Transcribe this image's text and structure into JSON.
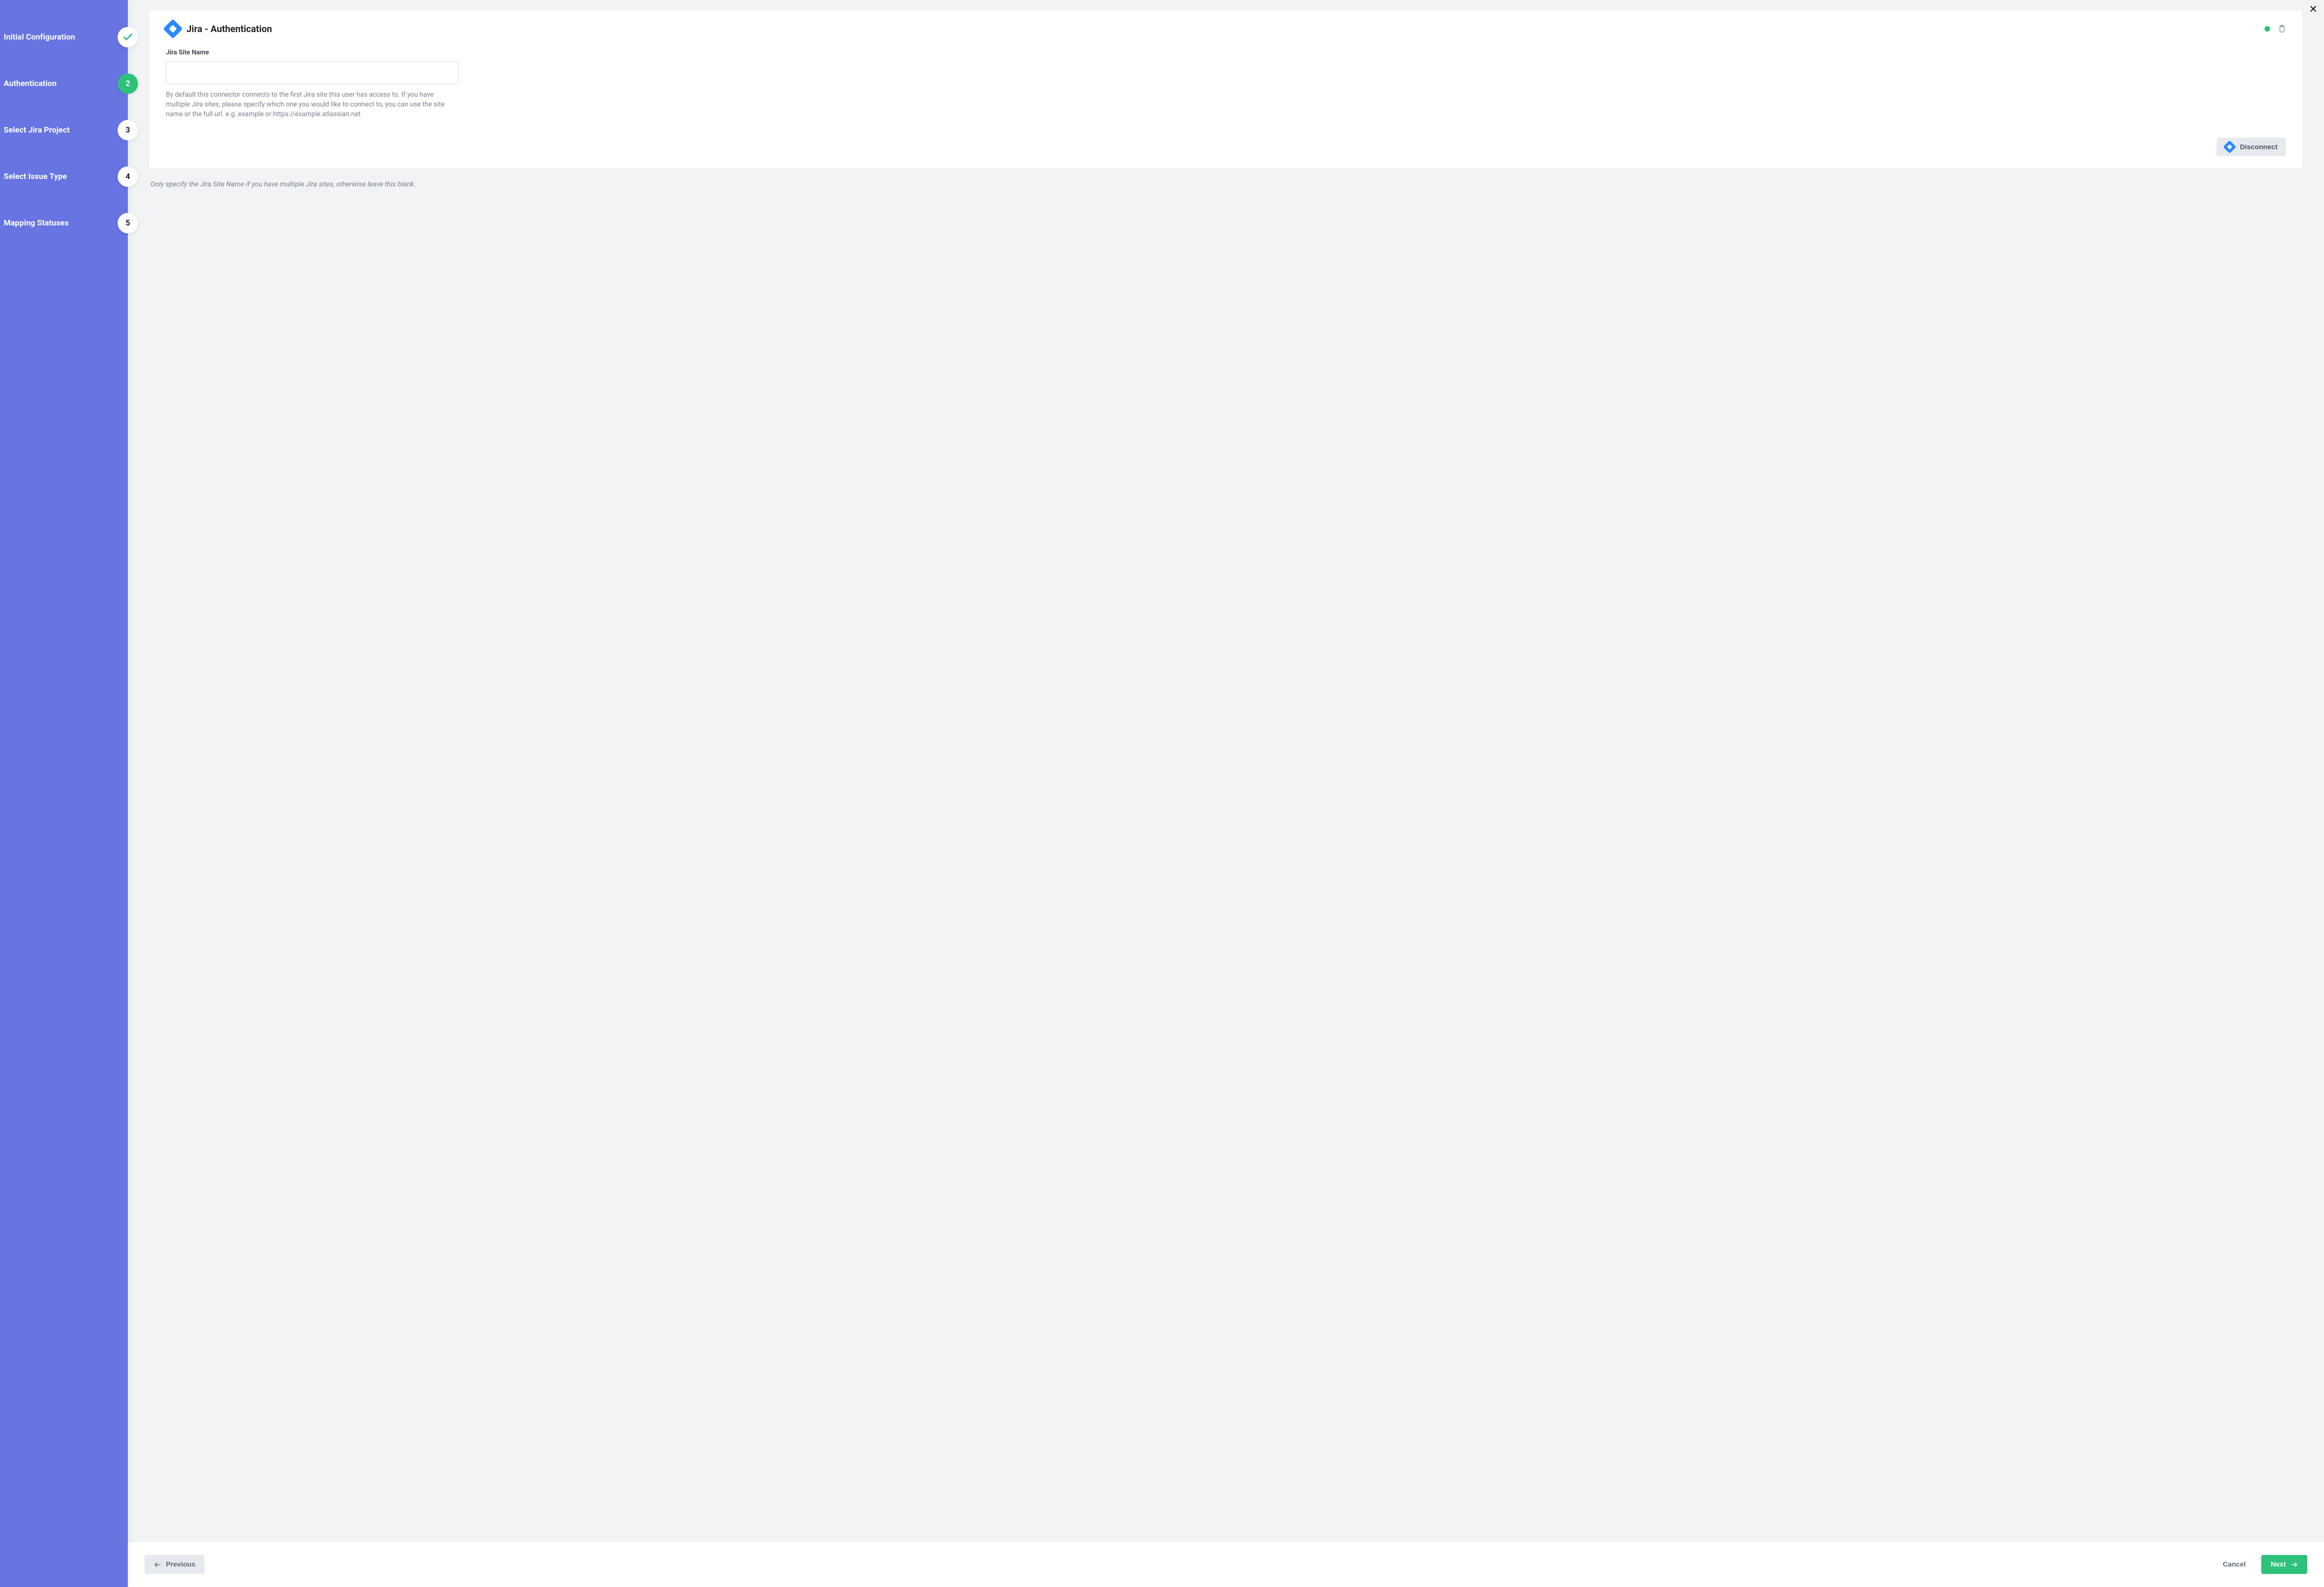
{
  "sidebar": {
    "steps": [
      {
        "label": "Initial Configuration",
        "state": "done",
        "badge": ""
      },
      {
        "label": "Authentication",
        "state": "current",
        "badge": "2"
      },
      {
        "label": "Select Jira Project",
        "state": "pending",
        "badge": "3"
      },
      {
        "label": "Select Issue Type",
        "state": "pending",
        "badge": "4"
      },
      {
        "label": "Mapping Statuses",
        "state": "pending",
        "badge": "5"
      }
    ]
  },
  "card": {
    "title": "Jira - Authentication",
    "form": {
      "label": "Jira Site Name",
      "value": "",
      "help": "By default this connector connects to the first Jira site this user has access to. If you have multiple Jira sites, please specify which one you would like to connect to, you can use the site name or the full url. e.g. example or https://example.atlassian.net"
    },
    "disconnect_label": "Disconnect"
  },
  "note": "Only specify the Jira Site Name if you have multiple Jira sites, otherwise leave this blank.",
  "footer": {
    "previous_label": "Previous",
    "cancel_label": "Cancel",
    "next_label": "Next"
  }
}
